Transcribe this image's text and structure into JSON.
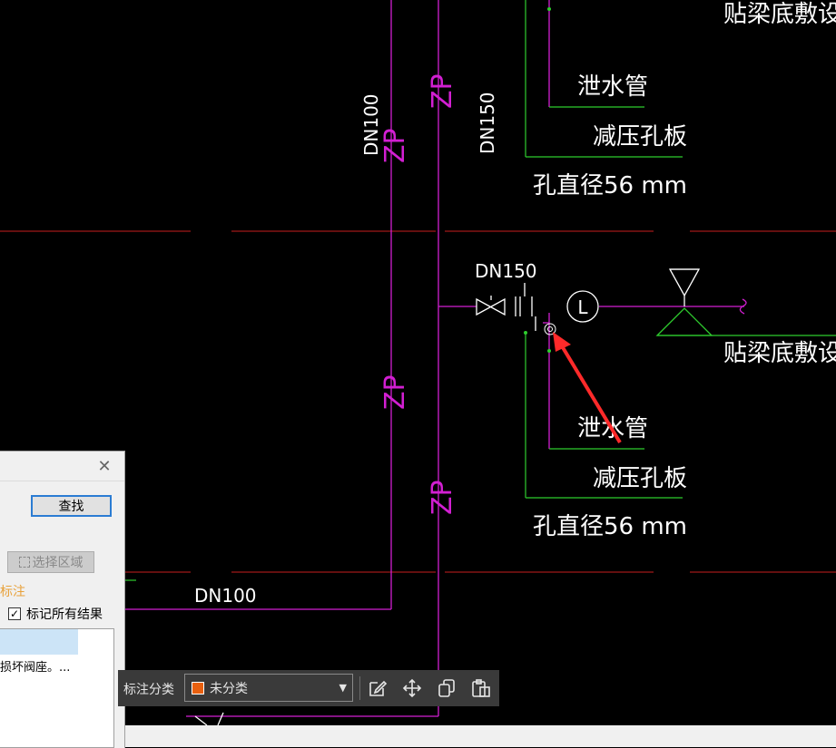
{
  "drawing": {
    "labels": {
      "top_right_note": "贴梁底敷设",
      "drain_pipe": "泄水管",
      "orifice_plate": "减压孔板",
      "hole_diameter": "孔直径56 mm",
      "dn100": "DN100",
      "dn150": "DN150",
      "zp": "ZP",
      "flow_switch": "L"
    },
    "colors": {
      "pipe": "#d21fd2",
      "axis": "#c81e1e",
      "leader": "#2ecc2e",
      "text": "#ffffff",
      "arrow": "#ff2a2a"
    }
  },
  "find_dialog": {
    "close_icon": "close-icon",
    "find_button": "查找",
    "select_area_button": "选择区域",
    "annotation_label": "标注",
    "mark_all_checkbox": {
      "label": "标记所有结果",
      "checked": true
    },
    "results": [
      {
        "text": ""
      },
      {
        "text": "损坏阀座。..."
      }
    ]
  },
  "annotation_toolbar": {
    "label": "标注分类",
    "category": {
      "value": "未分类",
      "color": "#e86010"
    },
    "tools": [
      "edit-icon",
      "move-icon",
      "copy-icon",
      "paste-icon"
    ]
  }
}
